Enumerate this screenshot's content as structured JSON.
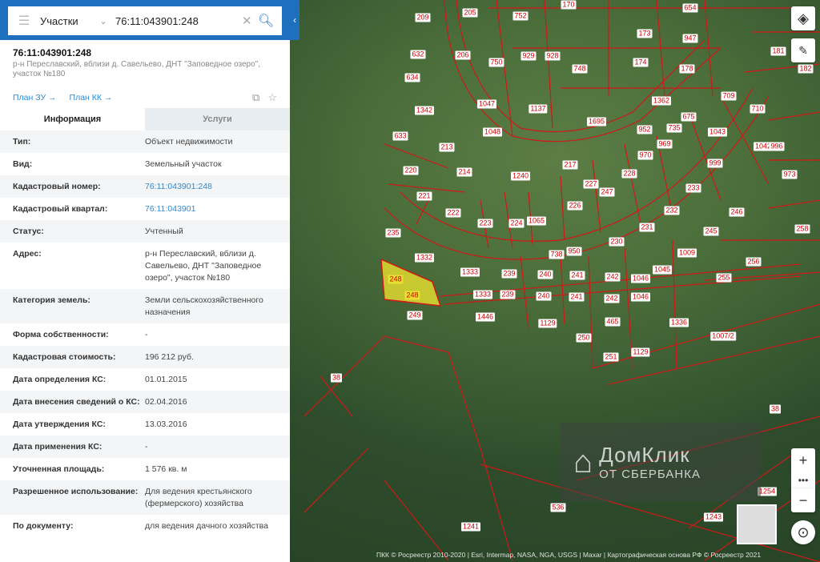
{
  "search": {
    "type_label": "Участки",
    "value": "76:11:043901:248"
  },
  "object": {
    "title": "76:11:043901:248",
    "address": "р-н Переславский, вблизи д. Савельево, ДНТ \"Заповедное озеро\", участок №180",
    "link_zu": "План ЗУ →",
    "link_kk": "План КК →"
  },
  "tabs": [
    {
      "label": "Информация",
      "active": true
    },
    {
      "label": "Услуги",
      "active": false
    }
  ],
  "rows": [
    {
      "k": "Тип:",
      "v": "Объект недвижимости"
    },
    {
      "k": "Вид:",
      "v": "Земельный участок"
    },
    {
      "k": "Кадастровый номер:",
      "v": "76:11:043901:248",
      "link": true
    },
    {
      "k": "Кадастровый квартал:",
      "v": "76:11:043901",
      "link": true
    },
    {
      "k": "Статус:",
      "v": "Учтенный"
    },
    {
      "k": "Адрес:",
      "v": "р-н Переславский, вблизи д. Савельево, ДНТ \"Заповедное озеро\", участок №180"
    },
    {
      "k": "Категория земель:",
      "v": "Земли сельскохозяйственного назначения"
    },
    {
      "k": "Форма собственности:",
      "v": "-"
    },
    {
      "k": "Кадастровая стоимость:",
      "v": "196 212 руб."
    },
    {
      "k": "Дата определения КС:",
      "v": "01.01.2015"
    },
    {
      "k": "Дата внесения сведений о КС:",
      "v": "02.04.2016"
    },
    {
      "k": "Дата утверждения КС:",
      "v": "13.03.2016"
    },
    {
      "k": "Дата применения КС:",
      "v": "-"
    },
    {
      "k": "Уточненная площадь:",
      "v": "1 576 кв. м"
    },
    {
      "k": "Разрешенное использование:",
      "v": "Для ведения крестьянского (фермерского) хозяйства"
    },
    {
      "k": "По документу:",
      "v": "для ведения дачного хозяйства"
    }
  ],
  "map": {
    "parcel_labels": [
      "209",
      "205",
      "752",
      "170",
      "654",
      "632",
      "206",
      "750",
      "929",
      "928",
      "173",
      "947",
      "634",
      "748",
      "174",
      "178",
      "181",
      "182",
      "1342",
      "1047",
      "1137",
      "1362",
      "709",
      "710",
      "633",
      "1048",
      "1695",
      "952",
      "735",
      "675",
      "1043",
      "213",
      "217",
      "970",
      "969",
      "999",
      "1042",
      "996",
      "220",
      "214",
      "1240",
      "228",
      "233",
      "973",
      "221",
      "227",
      "247",
      "222",
      "223",
      "224",
      "1065",
      "226",
      "231",
      "232",
      "246",
      "235",
      "230",
      "258",
      "1332",
      "738",
      "950",
      "245",
      "1009",
      "256",
      "248",
      "1333",
      "239",
      "240",
      "241",
      "242",
      "1046",
      "1045",
      "255",
      "1333",
      "239",
      "240",
      "241",
      "242",
      "1046",
      "249",
      "1446",
      "1129",
      "1336",
      "1007/2",
      "250",
      "251",
      "1129",
      "465",
      "38",
      "38",
      "536",
      "1241",
      "1243",
      "1254"
    ],
    "selected_parcel": "248",
    "watermark_line1": "ДомКлик",
    "watermark_line2": "ОТ СБЕРБАНКА",
    "attribution": "ПКК © Росреестр 2010-2020 | Esri, Intermap, NASA, NGA, USGS | Maxar | Картографическая основа РФ © Росреестр 2021",
    "colors": {
      "boundary": "#d01818",
      "selected_fill": "#e8e030",
      "header": "#1f6fbf"
    }
  }
}
